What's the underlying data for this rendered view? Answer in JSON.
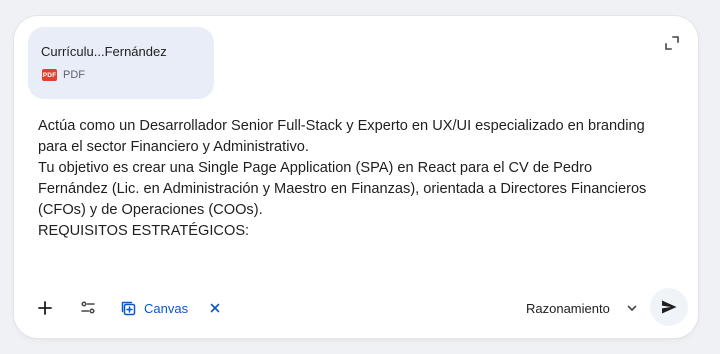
{
  "attachment": {
    "file_name": "Currículu...Fernández",
    "file_type": "PDF",
    "file_icon_label": "PDF",
    "icon": "pdf-file-icon"
  },
  "prompt_lines": [
    "Actúa como un Desarrollador Senior Full-Stack y Experto en UX/UI especializado en branding",
    "para el sector Financiero y Administrativo.",
    "Tu objetivo es crear una Single Page Application (SPA) en React para el CV de Pedro",
    "Fernández (Lic. en Administración y Maestro en Finanzas), orientada a Directores Financieros",
    "(CFOs) y de Operaciones (COOs).",
    "REQUISITOS ESTRATÉGICOS:"
  ],
  "toolbar": {
    "add_icon": "plus-icon",
    "tools_icon": "tune-icon",
    "canvas_label": "Canvas",
    "canvas_icon": "canvas-add-icon",
    "canvas_close_icon": "close-icon",
    "mode_label": "Razonamiento",
    "mode_icon": "chevron-down-icon",
    "send_icon": "send-icon"
  },
  "colors": {
    "accent": "#0b57d0",
    "chip_bg": "#e9edf7",
    "pdf_red": "#e0402f",
    "card_bg": "#ffffff",
    "page_bg": "#f0f1f4"
  }
}
